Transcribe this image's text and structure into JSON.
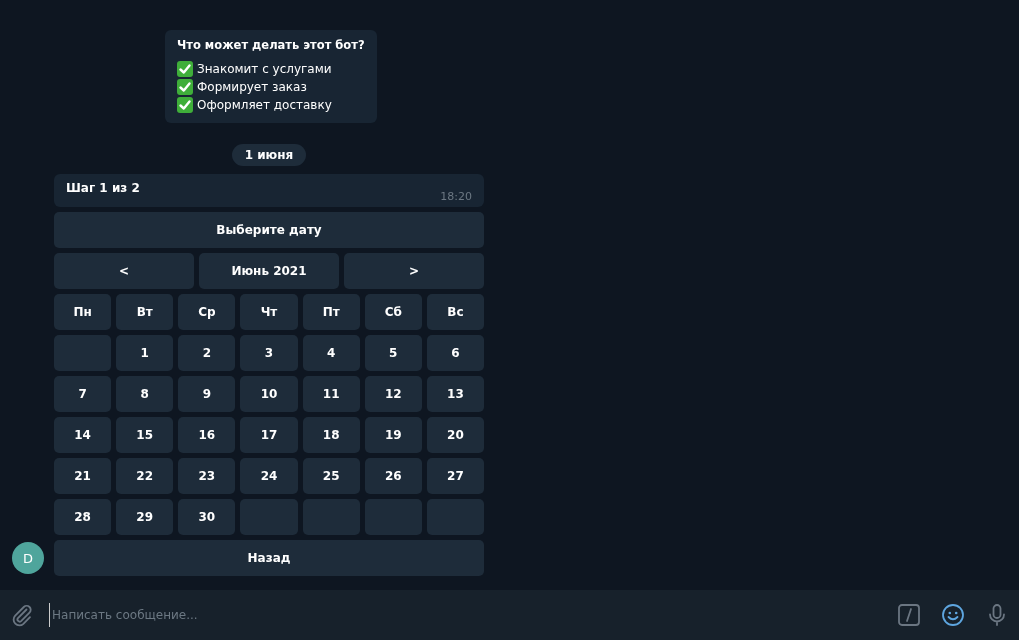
{
  "bot_info": {
    "title": "Что может делать этот бот?",
    "items": [
      "Знакомит с услугами",
      "Формирует заказ",
      "Оформляет доставку"
    ]
  },
  "date_separator": "1 июня",
  "message": {
    "text": "Шаг 1 из 2",
    "time": "18:20"
  },
  "keyboard": {
    "header": "Выберите дату",
    "prev": "<",
    "month": "Июнь 2021",
    "next": ">",
    "weekdays": [
      "Пн",
      "Вт",
      "Ср",
      "Чт",
      "Пт",
      "Сб",
      "Вс"
    ],
    "weeks": [
      [
        {
          "kind": "empty"
        },
        {
          "kind": "day",
          "label": "1"
        },
        {
          "kind": "day",
          "label": "2"
        },
        {
          "kind": "day",
          "label": "3"
        },
        {
          "kind": "day",
          "label": "4"
        },
        {
          "kind": "day",
          "label": "5"
        },
        {
          "kind": "day",
          "label": "6"
        }
      ],
      [
        {
          "kind": "day",
          "label": "7"
        },
        {
          "kind": "day",
          "label": "8"
        },
        {
          "kind": "day",
          "label": "9"
        },
        {
          "kind": "day",
          "label": "10"
        },
        {
          "kind": "day",
          "label": "11"
        },
        {
          "kind": "day",
          "label": "12"
        },
        {
          "kind": "day",
          "label": "13"
        }
      ],
      [
        {
          "kind": "day",
          "label": "14"
        },
        {
          "kind": "day",
          "label": "15"
        },
        {
          "kind": "day",
          "label": "16"
        },
        {
          "kind": "day",
          "label": "17"
        },
        {
          "kind": "day",
          "label": "18"
        },
        {
          "kind": "day",
          "label": "19"
        },
        {
          "kind": "day",
          "label": "20"
        }
      ],
      [
        {
          "kind": "day",
          "label": "21"
        },
        {
          "kind": "day",
          "label": "22"
        },
        {
          "kind": "day",
          "label": "23"
        },
        {
          "kind": "day",
          "label": "24"
        },
        {
          "kind": "day",
          "label": "25"
        },
        {
          "kind": "day",
          "label": "26"
        },
        {
          "kind": "day",
          "label": "27"
        }
      ],
      [
        {
          "kind": "day",
          "label": "28"
        },
        {
          "kind": "day",
          "label": "29"
        },
        {
          "kind": "day",
          "label": "30"
        },
        {
          "kind": "empty"
        },
        {
          "kind": "empty"
        },
        {
          "kind": "empty"
        },
        {
          "kind": "empty"
        }
      ]
    ],
    "back": "Назад"
  },
  "avatar": "D",
  "composer": {
    "placeholder": "Написать сообщение..."
  }
}
